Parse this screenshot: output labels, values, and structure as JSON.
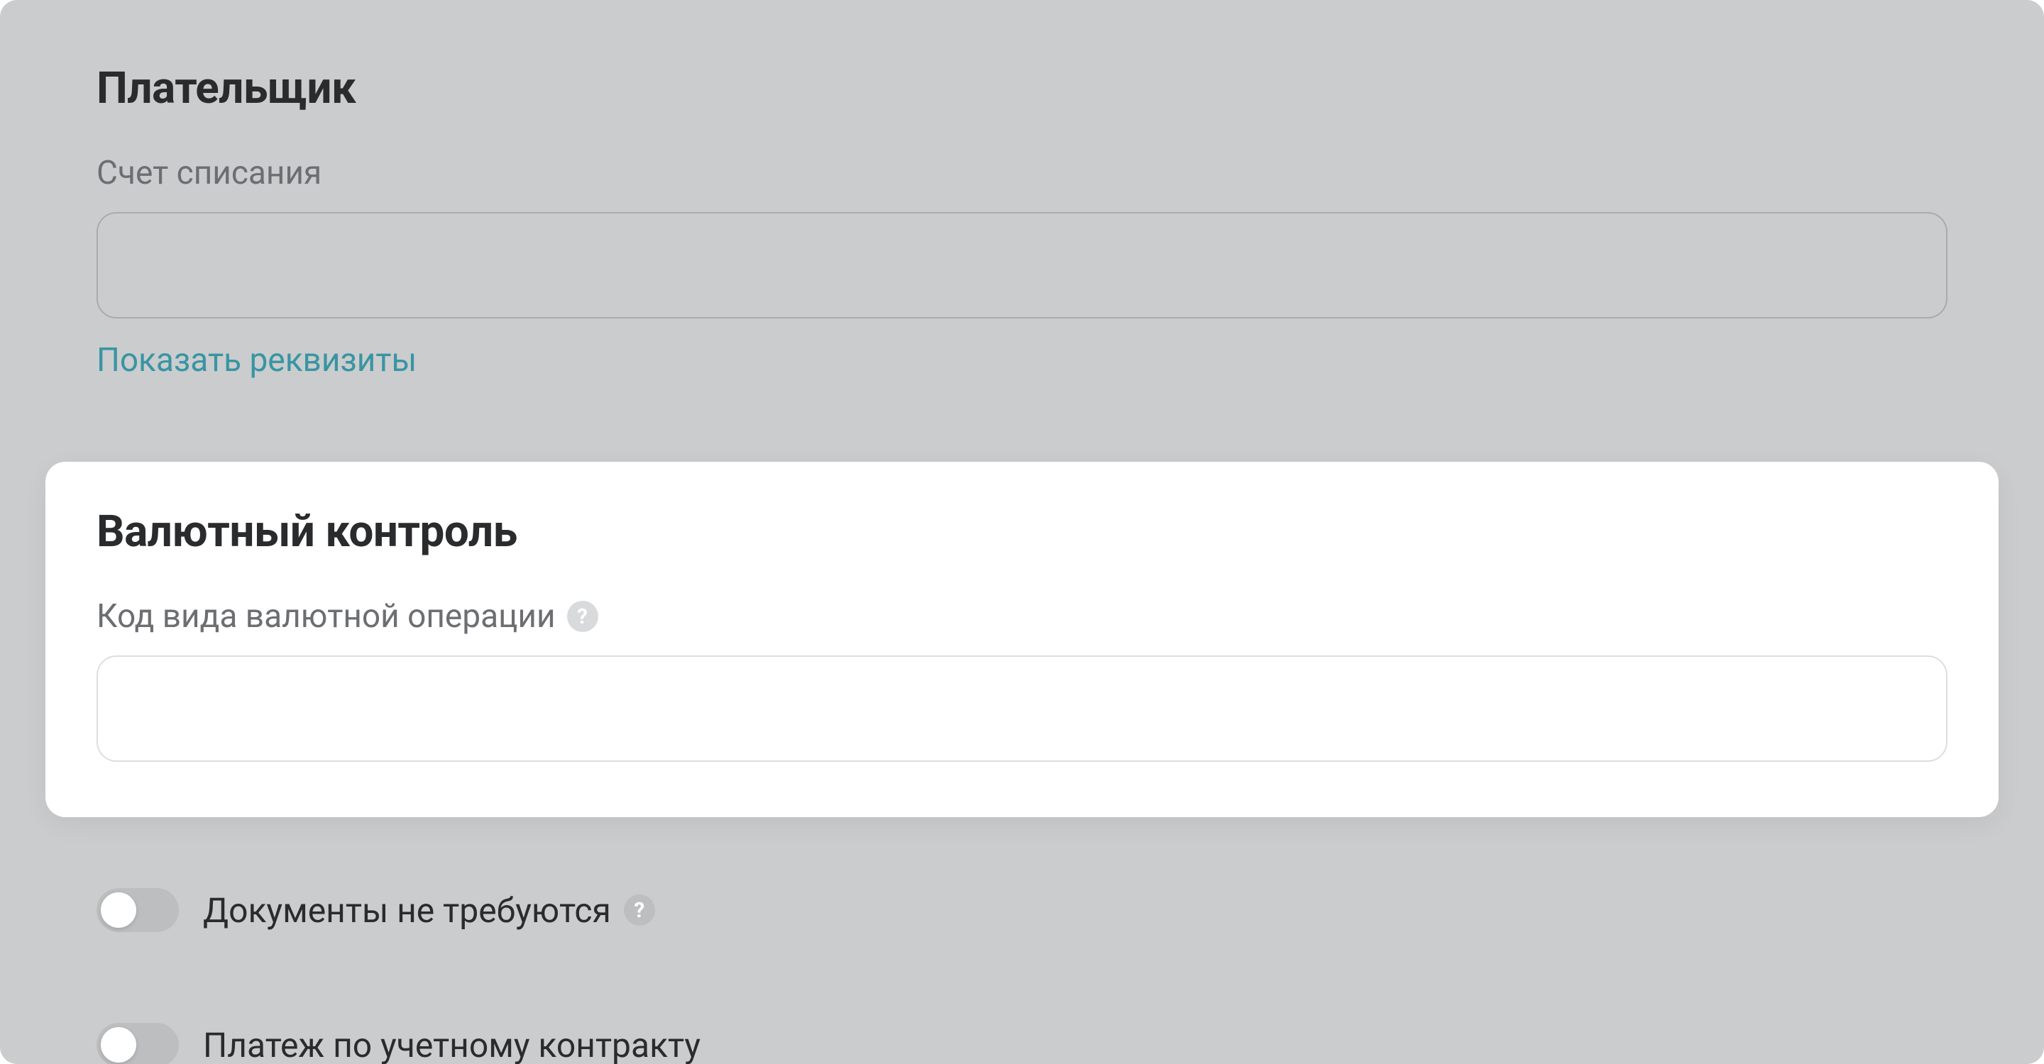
{
  "payer": {
    "heading": "Плательщик",
    "debit_account_label": "Счет списания",
    "debit_account_value": "",
    "show_details_link": "Показать реквизиты"
  },
  "currency_control": {
    "heading": "Валютный контроль",
    "code_label": "Код вида валютной операции",
    "code_value": ""
  },
  "toggles": {
    "no_docs_label": "Документы не требуются",
    "accounting_contract_label": "Платеж по учетному контракту"
  },
  "icons": {
    "help_glyph": "?"
  }
}
